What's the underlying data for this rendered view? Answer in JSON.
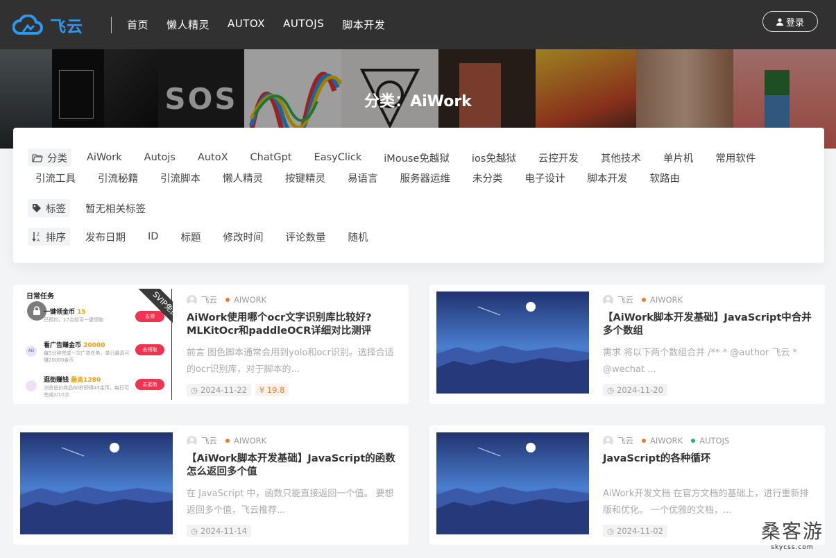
{
  "header": {
    "logo_text": "飞云",
    "nav": [
      "首页",
      "懒人精灵",
      "AUTOX",
      "AUTOJS",
      "脚本开发"
    ],
    "login_label": "登录"
  },
  "banner": {
    "title": "分类：AiWork"
  },
  "filters": {
    "category_label": "分类",
    "categories_row1": [
      "AiWork",
      "Autojs",
      "AutoX",
      "ChatGpt",
      "EasyClick",
      "iMouse免越狱",
      "ios免越狱",
      "云控开发",
      "其他技术",
      "单片机",
      "常用软件"
    ],
    "categories_row2": [
      "引流工具",
      "引流秘籍",
      "引流脚本",
      "懒人精灵",
      "按键精灵",
      "易语言",
      "服务器运维",
      "未分类",
      "电子设计",
      "脚本开发",
      "软路由"
    ],
    "tag_label": "标签",
    "tag_empty": "暂无相关标签",
    "sort_label": "排序",
    "sort_options": [
      "发布日期",
      "ID",
      "标题",
      "修改时间",
      "评论数量",
      "随机"
    ]
  },
  "thumb1": {
    "heading": "日常任务",
    "ribbon": "SVIP免费",
    "rows": [
      {
        "title": "一键领金币",
        "badge": "15",
        "sub": "已预约，17点前可一键领取",
        "btn": "去领"
      },
      {
        "title": "看广告赚金币",
        "badge": "20000",
        "sub": "每5分钟完成一次广告任务，单日最高可赚20000金币",
        "btn": "去领取"
      },
      {
        "title": "逛街赚钱",
        "badge": "最高1280",
        "sub": "浏览低价商品60秒即得43金币，每日可完成0/10次",
        "btn": "去逛街"
      }
    ]
  },
  "posts": [
    {
      "author": "飞云",
      "tags": [
        "AIWORK"
      ],
      "title": "AiWork使用哪个ocr文字识别库比较好?MLKitOcr和paddleOCR详细对比测评",
      "desc": "前言 图色脚本通常会用到yolo和ocr识别。选择合适的ocr识别库，对于脚本的...",
      "date": "2024-11-22",
      "price": "¥ 19.8"
    },
    {
      "author": "飞云",
      "tags": [
        "AIWORK"
      ],
      "title": "【AiWork脚本开发基础】JavaScript中合并多个数组",
      "desc": "需求 将以下两个数组合并 /** * @author 飞云 * @wechat ...",
      "date": "2024-11-20"
    },
    {
      "author": "飞云",
      "tags": [
        "AIWORK"
      ],
      "title": "【AiWork脚本开发基础】JavaScript的函数怎么返回多个值",
      "desc": "在 JavaScript 中，函数只能直接返回一个值。 要想返回多个值，飞云推荐...",
      "date": "2024-11-14"
    },
    {
      "author": "飞云",
      "tags": [
        "AIWORK",
        "AUTOJS"
      ],
      "title": "JavaScript的各种循环",
      "desc": "AiWork开发文档 在官方文档的基础上，进行重新排版和优化。 一个优雅的文档，...",
      "date": "2024-11-02"
    }
  ],
  "colors": {
    "header_bg": "#313131",
    "brand": "#2a9af3",
    "tag_orange": "#f07c2b",
    "tag_green": "#2ab55a"
  },
  "watermark": {
    "main": "桑客游",
    "sub": "skycss.com"
  }
}
